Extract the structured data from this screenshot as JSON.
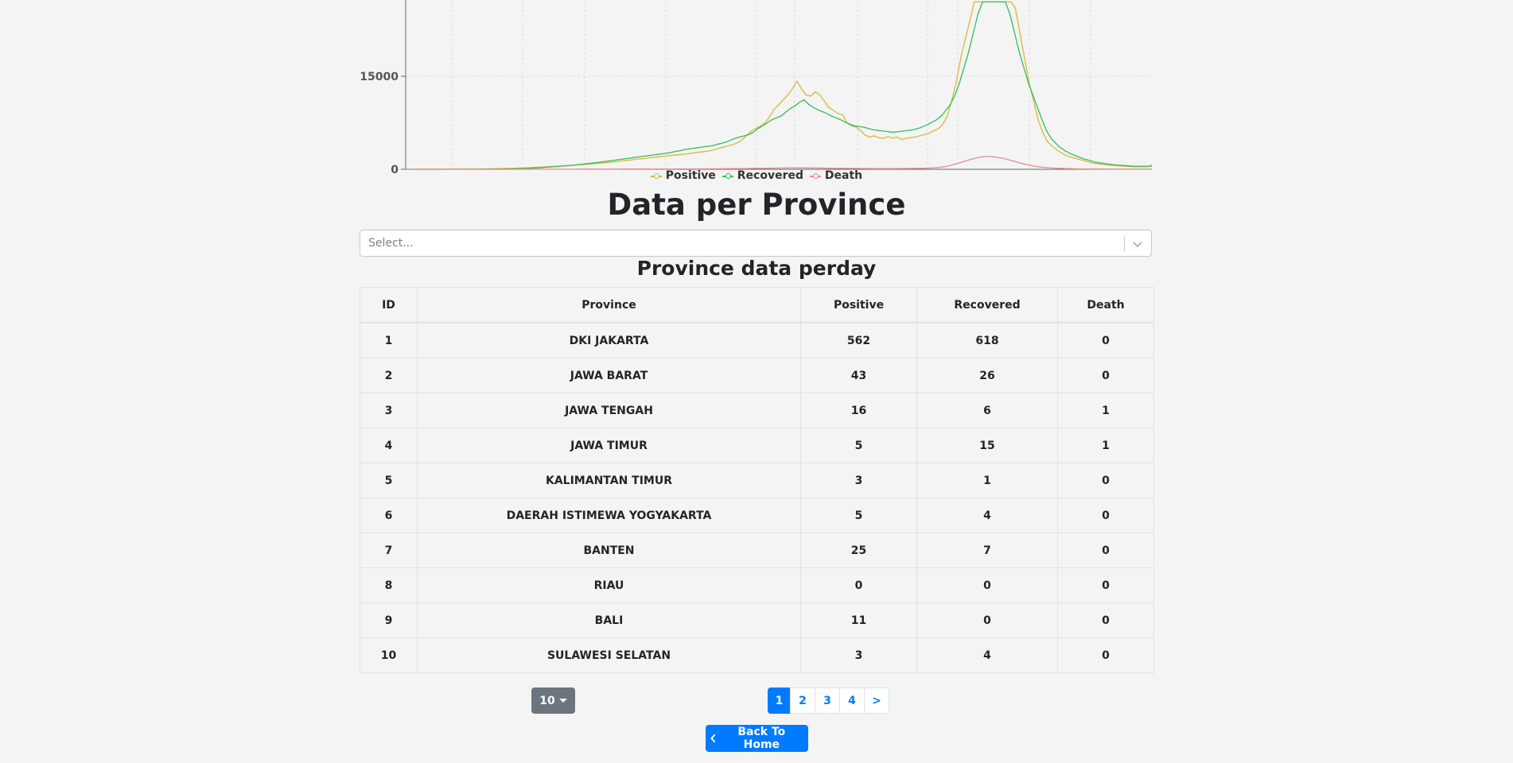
{
  "chart_data": {
    "type": "line",
    "y_ticks": [
      "0",
      "15000"
    ],
    "ylim": [
      0,
      27000
    ],
    "grid": true,
    "legend_position": "bottom",
    "series": [
      {
        "name": "Positive",
        "color": "#d9b73a",
        "values": [
          5,
          5,
          6,
          7,
          8,
          9,
          10,
          12,
          14,
          16,
          18,
          20,
          25,
          30,
          35,
          42,
          50,
          60,
          70,
          85,
          100,
          120,
          140,
          160,
          185,
          200,
          230,
          260,
          290,
          330,
          370,
          410,
          450,
          490,
          530,
          580,
          620,
          660,
          700,
          760,
          820,
          880,
          950,
          1000,
          1070,
          1150,
          1200,
          1300,
          1400,
          1450,
          1550,
          1650,
          1700,
          1800,
          1900,
          1950,
          2050,
          2100,
          2200,
          2300,
          2350,
          2400,
          2500,
          2600,
          2700,
          2800,
          2900,
          3000,
          3200,
          3400,
          3600,
          3800,
          4000,
          4300,
          4800,
          5500,
          6200,
          6600,
          7000,
          7500,
          8500,
          9700,
          10400,
          11200,
          12000,
          13000,
          14200,
          13000,
          12000,
          11800,
          12500,
          12000,
          11000,
          10000,
          9500,
          9000,
          8800,
          7500,
          7000,
          6800,
          6200,
          5500,
          5200,
          5400,
          5100,
          5000,
          5300,
          5000,
          5200,
          4800,
          5000,
          5100,
          5200,
          5400,
          5600,
          5800,
          6200,
          6500,
          7200,
          8500,
          11000,
          14000,
          18000,
          21000,
          24000,
          27000,
          27000,
          27000,
          27000,
          27000,
          27000,
          27000,
          27000,
          27000,
          26000,
          22000,
          18000,
          14000,
          11000,
          8000,
          6000,
          4500,
          3800,
          3200,
          2700,
          2300,
          2000,
          1800,
          1600,
          1400,
          1200,
          1000,
          900,
          800,
          700,
          650,
          600,
          550,
          500,
          450,
          400,
          400,
          400,
          400,
          700
        ]
      },
      {
        "name": "Recovered",
        "color": "#2fbf5a",
        "values": [
          2,
          2,
          2,
          3,
          3,
          3,
          4,
          5,
          6,
          7,
          8,
          9,
          10,
          12,
          14,
          16,
          20,
          24,
          28,
          32,
          40,
          48,
          56,
          64,
          80,
          96,
          120,
          150,
          190,
          230,
          280,
          330,
          390,
          450,
          510,
          560,
          620,
          700,
          780,
          860,
          940,
          1020,
          1100,
          1200,
          1300,
          1400,
          1500,
          1600,
          1700,
          1800,
          1900,
          2000,
          2100,
          2200,
          2300,
          2400,
          2500,
          2600,
          2700,
          2900,
          3000,
          3200,
          3300,
          3400,
          3500,
          3600,
          3700,
          3800,
          4000,
          4200,
          4400,
          4700,
          5000,
          5200,
          5400,
          5600,
          6000,
          6600,
          7000,
          7500,
          8000,
          8300,
          8600,
          9200,
          9800,
          10200,
          10800,
          11200,
          10500,
          10000,
          9600,
          9300,
          9000,
          8600,
          8300,
          8000,
          7600,
          7300,
          7000,
          6900,
          6800,
          6600,
          6400,
          6300,
          6200,
          6100,
          6000,
          6000,
          6100,
          6200,
          6300,
          6400,
          6600,
          6900,
          7200,
          7600,
          8000,
          8600,
          9500,
          10500,
          12000,
          14000,
          16500,
          19000,
          22000,
          25000,
          27000,
          27000,
          27000,
          27000,
          27000,
          27000,
          25000,
          22000,
          19000,
          16500,
          14000,
          12000,
          10000,
          8000,
          6200,
          5000,
          4200,
          3500,
          3000,
          2600,
          2300,
          2000,
          1700,
          1500,
          1300,
          1100,
          1000,
          900,
          800,
          700,
          650,
          600,
          550,
          500,
          500,
          500,
          500,
          500
        ]
      },
      {
        "name": "Death",
        "color": "#e58c8c",
        "values": [
          0,
          0,
          0,
          0,
          0,
          0,
          0,
          0,
          0,
          0,
          0,
          0,
          1,
          1,
          1,
          1,
          2,
          2,
          2,
          3,
          3,
          4,
          4,
          5,
          6,
          7,
          8,
          9,
          10,
          11,
          12,
          13,
          14,
          15,
          16,
          17,
          18,
          19,
          20,
          21,
          22,
          23,
          24,
          25,
          26,
          28,
          30,
          32,
          34,
          36,
          38,
          40,
          42,
          44,
          46,
          48,
          50,
          52,
          54,
          56,
          58,
          60,
          62,
          64,
          66,
          70,
          75,
          80,
          85,
          90,
          95,
          100,
          105,
          110,
          115,
          120,
          130,
          140,
          150,
          160,
          170,
          180,
          190,
          200,
          210,
          220,
          230,
          240,
          230,
          220,
          210,
          200,
          190,
          180,
          170,
          160,
          150,
          150,
          145,
          140,
          135,
          130,
          125,
          120,
          115,
          110,
          110,
          110,
          115,
          120,
          125,
          130,
          140,
          150,
          160,
          175,
          200,
          240,
          300,
          400,
          550,
          750,
          950,
          1150,
          1400,
          1600,
          1800,
          1950,
          2050,
          2100,
          2000,
          1900,
          1800,
          1600,
          1400,
          1200,
          1000,
          800,
          650,
          500,
          400,
          320,
          260,
          210,
          170,
          140,
          120,
          100,
          80,
          70,
          60,
          50,
          45,
          40,
          35,
          30,
          30,
          25,
          25,
          20,
          20,
          20,
          20,
          20,
          20,
          20
        ]
      }
    ]
  },
  "page": {
    "section_title": "Data per Province",
    "select_placeholder": "Select...",
    "table_title": "Province data perday",
    "back_label": "Back To Home"
  },
  "table": {
    "headers": [
      "ID",
      "Province",
      "Positive",
      "Recovered",
      "Death"
    ],
    "rows": [
      [
        "1",
        "DKI JAKARTA",
        "562",
        "618",
        "0"
      ],
      [
        "2",
        "JAWA BARAT",
        "43",
        "26",
        "0"
      ],
      [
        "3",
        "JAWA TENGAH",
        "16",
        "6",
        "1"
      ],
      [
        "4",
        "JAWA TIMUR",
        "5",
        "15",
        "1"
      ],
      [
        "5",
        "KALIMANTAN TIMUR",
        "3",
        "1",
        "0"
      ],
      [
        "6",
        "DAERAH ISTIMEWA YOGYAKARTA",
        "5",
        "4",
        "0"
      ],
      [
        "7",
        "BANTEN",
        "25",
        "7",
        "0"
      ],
      [
        "8",
        "RIAU",
        "0",
        "0",
        "0"
      ],
      [
        "9",
        "BALI",
        "11",
        "0",
        "0"
      ],
      [
        "10",
        "SULAWESI SELATAN",
        "3",
        "4",
        "0"
      ]
    ]
  },
  "pagination": {
    "page_size": "10",
    "pages": [
      "1",
      "2",
      "3",
      "4"
    ],
    "next_label": ">",
    "active_page": "1"
  },
  "colors": {
    "primary": "#007bff",
    "secondary": "#6c757d"
  },
  "icons": {
    "select_indicator": "chevron-down-icon",
    "back_icon": "chevron-left-icon"
  }
}
